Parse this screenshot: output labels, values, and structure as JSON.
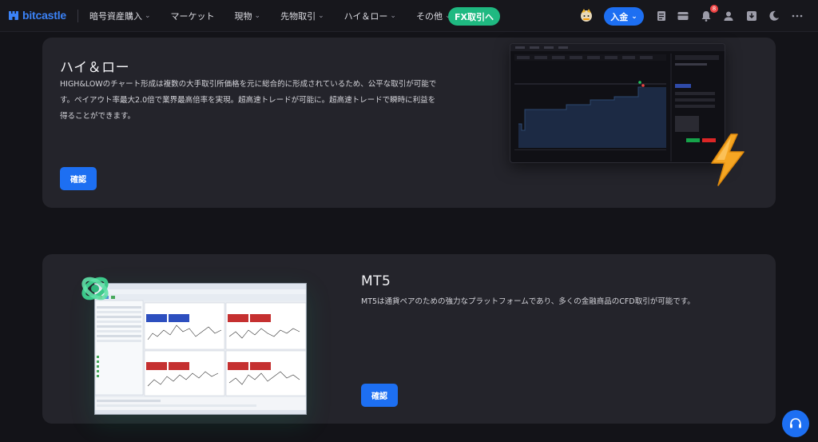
{
  "nav": {
    "logo_text": "bitcastle",
    "menu": [
      {
        "label": "暗号資産購入",
        "has_dropdown": true
      },
      {
        "label": "マーケット",
        "has_dropdown": false
      },
      {
        "label": "現物",
        "has_dropdown": true
      },
      {
        "label": "先物取引",
        "has_dropdown": true
      },
      {
        "label": "ハイ＆ロー",
        "has_dropdown": true
      },
      {
        "label": "その他",
        "has_dropdown": true
      }
    ],
    "fx_button": "FX取引へ",
    "deposit_button": "入金",
    "notification_count": "8",
    "icons": [
      "orders-icon",
      "wallet-card-icon",
      "bell-icon",
      "user-icon",
      "download-icon",
      "moon-icon",
      "more-icon"
    ]
  },
  "cards": [
    {
      "title": "ハイ＆ロー",
      "description_lines": [
        "HIGH&LOWのチャート形成は複数の大手取引所価格を元に総合的に形成されているため、公平な取引が可能で",
        "す。ペイアウト率最大2.0倍で業界最高倍率を実現。超高速トレードが可能に。超高速トレードで瞬時に利益を",
        "得ることができます。"
      ],
      "button": "確認"
    },
    {
      "title": "MT5",
      "description": "MT5は通貨ペアのための強力なプラットフォームであり、多くの金融商品のCFD取引が可能です。",
      "button": "確認"
    }
  ],
  "colors": {
    "accent": "#1d6ff2",
    "fx_green": "#1fb981",
    "card_bg": "#24242b",
    "page_bg": "#131318"
  }
}
